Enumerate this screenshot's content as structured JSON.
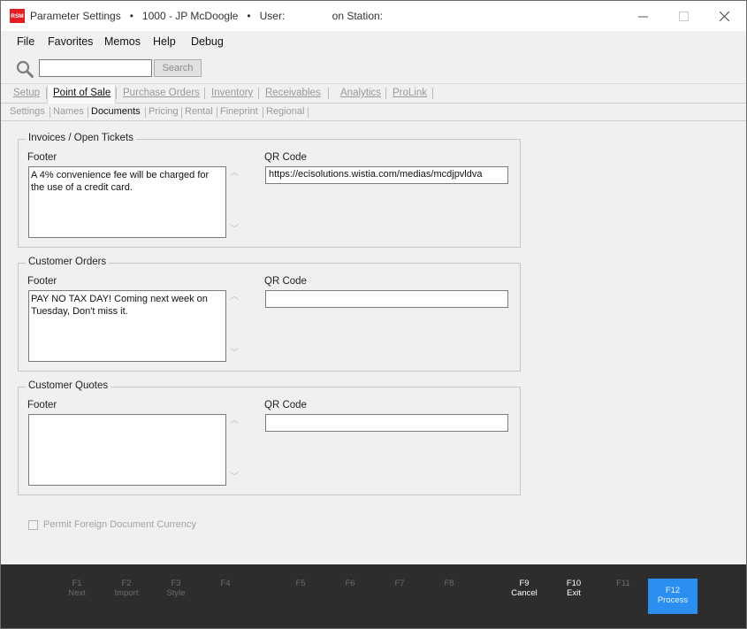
{
  "window": {
    "logo": "RSM",
    "title": "Parameter Settings   •   1000 - JP McDoogle   •   User:                on Station:",
    "min": "—",
    "max": "☐",
    "close": "✕"
  },
  "menu": [
    "File",
    "Favorites",
    "Memos",
    "Help",
    "Debug"
  ],
  "search": {
    "value": "",
    "button": "Search"
  },
  "tabs": [
    {
      "label": "Setup",
      "active": false
    },
    {
      "label": "Point of Sale",
      "active": true
    },
    {
      "label": "Purchase Orders",
      "active": false
    },
    {
      "label": "Inventory",
      "active": false
    },
    {
      "label": "Receivables",
      "active": false
    },
    {
      "label": "Analytics",
      "active": false
    },
    {
      "label": "ProLink",
      "active": false
    }
  ],
  "subtabs": [
    {
      "label": "Settings",
      "active": false
    },
    {
      "label": "Names",
      "active": false
    },
    {
      "label": "Documents",
      "active": true
    },
    {
      "label": "Pricing",
      "active": false
    },
    {
      "label": "Rental",
      "active": false
    },
    {
      "label": "Fineprint",
      "active": false
    },
    {
      "label": "Regional",
      "active": false
    }
  ],
  "groups": {
    "invoices": {
      "title": "Invoices / Open Tickets",
      "footer_label": "Footer",
      "footer_value": "A 4% convenience fee will be charged for\nthe use of a credit card.",
      "qr_label": "QR Code",
      "qr_value": "https://ecisolutions.wistia.com/medias/mcdjpvldva"
    },
    "orders": {
      "title": "Customer Orders",
      "footer_label": "Footer",
      "footer_value": "PAY NO TAX DAY! Coming next week on\nTuesday, Don't miss it.",
      "qr_label": "QR Code",
      "qr_value": ""
    },
    "quotes": {
      "title": "Customer Quotes",
      "footer_label": "Footer",
      "footer_value": "",
      "qr_label": "QR Code",
      "qr_value": ""
    }
  },
  "permit": {
    "label": "Permit Foreign Document Currency",
    "checked": false
  },
  "fkeys": [
    {
      "key": "F1",
      "label": "Next",
      "enabled": false
    },
    {
      "key": "F2",
      "label": "Import",
      "enabled": false
    },
    {
      "key": "F3",
      "label": "Style",
      "enabled": false
    },
    {
      "key": "F4",
      "label": "",
      "enabled": false
    },
    {
      "key": "F5",
      "label": "",
      "enabled": false
    },
    {
      "key": "F6",
      "label": "",
      "enabled": false
    },
    {
      "key": "F7",
      "label": "",
      "enabled": false
    },
    {
      "key": "F8",
      "label": "",
      "enabled": false
    },
    {
      "key": "F9",
      "label": "Cancel",
      "enabled": true
    },
    {
      "key": "F10",
      "label": "Exit",
      "enabled": true
    },
    {
      "key": "F11",
      "label": "",
      "enabled": false
    },
    {
      "key": "F12",
      "label": "Process",
      "enabled": true
    }
  ],
  "colors": {
    "accent": "#2a8ff0",
    "logo_red": "#e31e24",
    "fkey_bar": "#2d2d2d"
  }
}
